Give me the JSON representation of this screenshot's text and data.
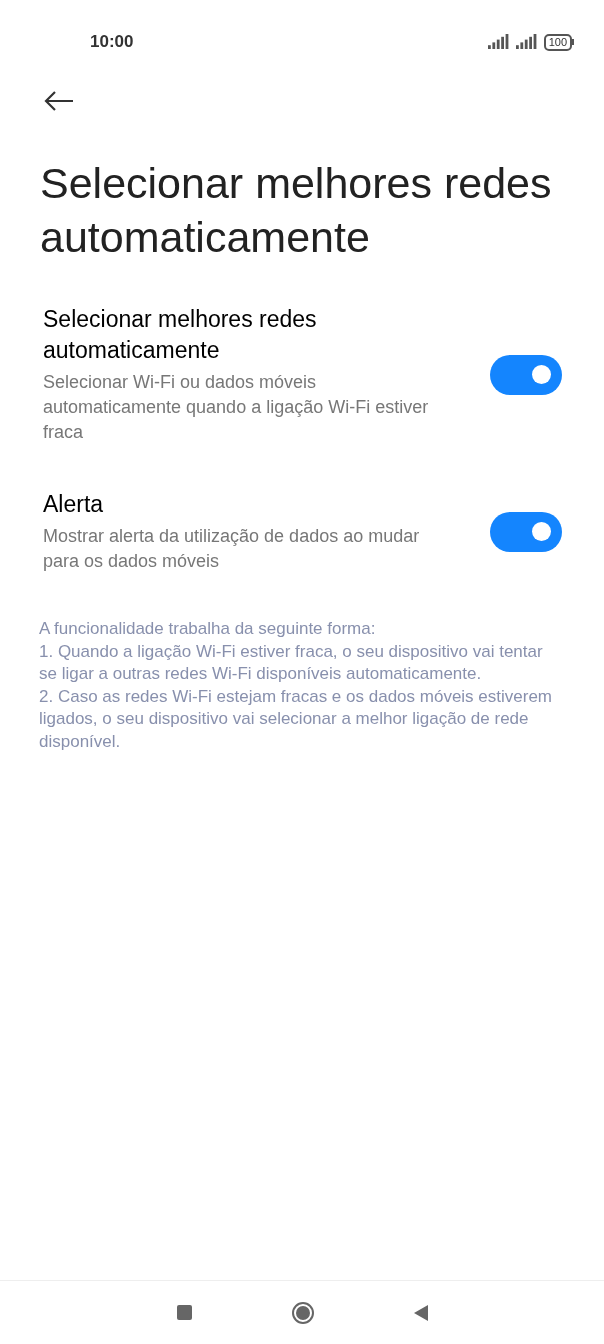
{
  "status_bar": {
    "time": "10:00",
    "battery": "100"
  },
  "title": "Selecionar melhores redes automaticamente",
  "settings": [
    {
      "title": "Selecionar melhores redes automaticamente",
      "description": "Selecionar Wi-Fi ou dados móveis automaticamente quando a ligação Wi-Fi estiver fraca",
      "on": true
    },
    {
      "title": "Alerta",
      "description": "Mostrar alerta da utilização de dados ao mudar para os dados móveis",
      "on": true
    }
  ],
  "info": [
    "A funcionalidade trabalha da seguinte forma:",
    "1. Quando a ligação Wi-Fi estiver fraca, o seu dispositivo vai tentar se ligar a outras redes Wi-Fi disponíveis automaticamente.",
    "2. Caso as redes Wi-Fi estejam fracas e os dados móveis estiverem ligados, o seu dispositivo vai selecionar a melhor ligação de rede disponível."
  ]
}
